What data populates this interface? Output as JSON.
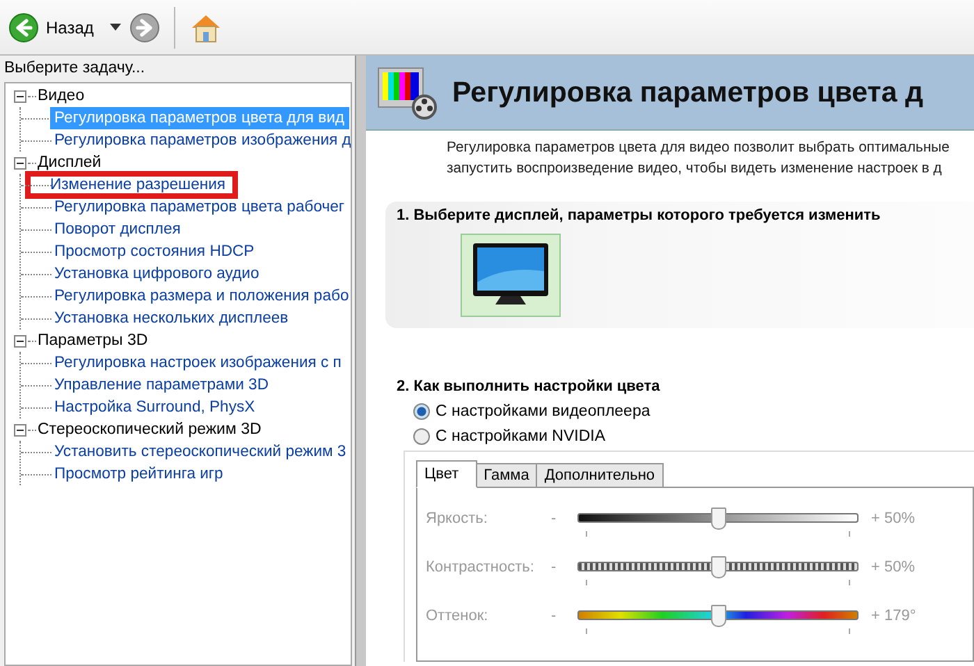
{
  "toolbar": {
    "back_label": "Назад"
  },
  "task_panel": {
    "title": "Выберите задачу...",
    "tree": [
      {
        "label": "Видео",
        "expanded": true,
        "children": [
          {
            "label": "Регулировка параметров цвета для вид",
            "selected": true,
            "highlighted": false
          },
          {
            "label": "Регулировка параметров изображения д",
            "selected": false,
            "highlighted": false
          }
        ]
      },
      {
        "label": "Дисплей",
        "expanded": true,
        "children": [
          {
            "label": "Изменение разрешения",
            "selected": false,
            "highlighted": true
          },
          {
            "label": "Регулировка параметров цвета рабочег",
            "selected": false,
            "highlighted": false
          },
          {
            "label": "Поворот дисплея",
            "selected": false,
            "highlighted": false
          },
          {
            "label": "Просмотр состояния HDCP",
            "selected": false,
            "highlighted": false
          },
          {
            "label": "Установка цифрового аудио",
            "selected": false,
            "highlighted": false
          },
          {
            "label": "Регулировка размера и положения рабо",
            "selected": false,
            "highlighted": false
          },
          {
            "label": "Установка нескольких дисплеев",
            "selected": false,
            "highlighted": false
          }
        ]
      },
      {
        "label": "Параметры 3D",
        "expanded": true,
        "children": [
          {
            "label": "Регулировка настроек изображения с п",
            "selected": false,
            "highlighted": false
          },
          {
            "label": "Управление параметрами 3D",
            "selected": false,
            "highlighted": false
          },
          {
            "label": "Настройка Surround, PhysX",
            "selected": false,
            "highlighted": false
          }
        ]
      },
      {
        "label": "Стереоскопический режим 3D",
        "expanded": true,
        "children": [
          {
            "label": "Установить стереоскопический режим 3",
            "selected": false,
            "highlighted": false
          },
          {
            "label": "Просмотр рейтинга игр",
            "selected": false,
            "highlighted": false
          }
        ]
      }
    ]
  },
  "page": {
    "title": "Регулировка параметров цвета д",
    "description": [
      "Регулировка параметров цвета для видео позволит выбрать оптимальные",
      "запустить воспроизведение видео, чтобы видеть изменение настроек в д"
    ],
    "section_1": {
      "heading": "1. Выберите дисплей, параметры которого требуется изменить",
      "displays": [
        {
          "selected": true
        }
      ]
    },
    "section_2": {
      "heading": "2. Как выполнить настройки цвета",
      "options": [
        {
          "label": "С настройками видеоплеера",
          "selected": true
        },
        {
          "label": "С настройками NVIDIA",
          "selected": false
        }
      ],
      "settings": {
        "disabled": true,
        "tabs": [
          {
            "label": "Цвет",
            "selected": true
          },
          {
            "label": "Гамма",
            "selected": false
          },
          {
            "label": "Дополнительно",
            "selected": false
          }
        ],
        "sliders": [
          {
            "kind": "brightness",
            "label": "Яркость:",
            "minus": "-",
            "reading": "+ 50%",
            "level": 0.5
          },
          {
            "kind": "contrast",
            "label": "Контрастность:",
            "minus": "-",
            "reading": "+ 50%",
            "level": 0.5
          },
          {
            "kind": "hue",
            "label": "Оттенок:",
            "minus": "-",
            "reading": "+ 179°",
            "level": 0.5
          }
        ]
      }
    }
  }
}
